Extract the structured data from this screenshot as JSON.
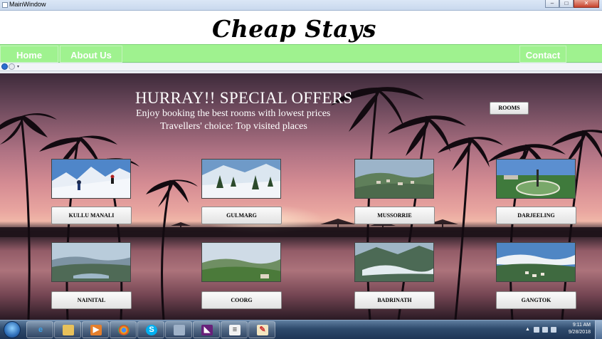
{
  "window": {
    "title": "MainWindow",
    "minimize": "–",
    "maximize": "□",
    "close": "✕"
  },
  "header": {
    "brand": "Cheap Stays"
  },
  "nav": {
    "home": "Home",
    "about": "About Us",
    "contact": "Contact Us"
  },
  "hero": {
    "title": "HURRAY!! SPECIAL OFFERS",
    "subtitle1": "Enjoy booking the best rooms with lowest prices",
    "subtitle2": "Travellers' choice: Top visited places",
    "rooms_button": "ROOMS"
  },
  "destinations": [
    {
      "name": "KULLU MANALI",
      "scene": "snow-ski"
    },
    {
      "name": "GULMARG",
      "scene": "snow-trees"
    },
    {
      "name": "MUSSORRIE",
      "scene": "hill-town"
    },
    {
      "name": "DARJEELING",
      "scene": "garden-circle"
    },
    {
      "name": "NAINITAL",
      "scene": "lake-valley"
    },
    {
      "name": "COORG",
      "scene": "green-hills"
    },
    {
      "name": "BADRINATH",
      "scene": "misty-valley"
    },
    {
      "name": "GANGTOK",
      "scene": "cloud-town"
    }
  ],
  "taskbar": {
    "apps": [
      "internet-explorer-icon",
      "file-explorer-icon",
      "media-player-icon",
      "chrome-icon",
      "skype-icon",
      "network-tool-icon",
      "visual-studio-icon",
      "document-icon",
      "paint-icon"
    ],
    "time": "9:11 AM",
    "date": "9/28/2018"
  }
}
